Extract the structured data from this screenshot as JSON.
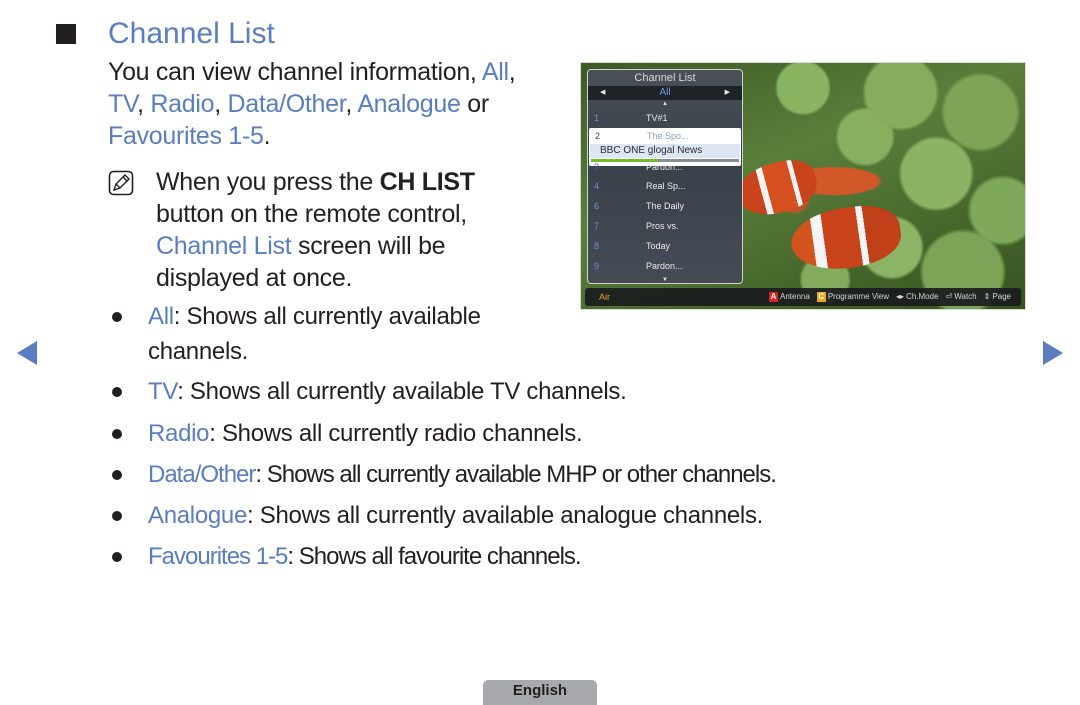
{
  "heading": {
    "title": "Channel List"
  },
  "intro": {
    "prefix": "You can view channel information, ",
    "links": [
      "All",
      "TV",
      "Radio",
      "Data/Other",
      "Analogue",
      "Favourites 1-5"
    ],
    "sep_comma": ", ",
    "sep_or": " or ",
    "end": "."
  },
  "note": {
    "text_before": "When you press the ",
    "key_label": "CH LIST",
    "text_middle": " button on the remote control, ",
    "link": "Channel List",
    "text_after": " screen will be displayed at once."
  },
  "bullets": [
    {
      "term": "All",
      "desc": ": Shows all currently available channels."
    },
    {
      "term": "TV",
      "desc": ": Shows all currently available TV channels."
    },
    {
      "term": "Radio",
      "desc": ": Shows all currently radio channels."
    },
    {
      "term": "Data/Other",
      "desc": ": Shows all currently available MHP or other channels."
    },
    {
      "term": "Analogue",
      "desc": ": Shows all currently available analogue channels."
    },
    {
      "term": "Favourites 1-5",
      "desc": ": Shows all favourite channels."
    }
  ],
  "navigation": {
    "prev_icon": "triangle-left-icon",
    "next_icon": "triangle-right-icon"
  },
  "footer": {
    "language": "English"
  },
  "tv_screen": {
    "panel_title": "Channel List",
    "current_tab": "All",
    "channels": [
      {
        "number": "1",
        "name": "TV#1"
      },
      {
        "number": "2",
        "name": "The Spo...",
        "selected": true,
        "program": "BBC ONE glogal News",
        "progress": 0.45
      },
      {
        "number": "3",
        "name": "Pardon..."
      },
      {
        "number": "4",
        "name": "Real Sp..."
      },
      {
        "number": "6",
        "name": "The Daily"
      },
      {
        "number": "7",
        "name": "Pros vs."
      },
      {
        "number": "8",
        "name": "Today"
      },
      {
        "number": "9",
        "name": "Pardon..."
      }
    ],
    "source": "Air",
    "hints": [
      {
        "key": "A",
        "label": "Antenna"
      },
      {
        "key": "C",
        "label": "Programme View"
      },
      {
        "glyph": "◂▸",
        "label": "Ch.Mode"
      },
      {
        "glyph": "⏎",
        "label": "Watch"
      },
      {
        "glyph": "⇕",
        "label": "Page"
      }
    ],
    "colors": {
      "key_a": "#e02020",
      "key_c": "#f0a81a",
      "source": "#f3a21c",
      "progress": "#6fbf2a",
      "tab_active": "#6f9be0"
    }
  },
  "colors": {
    "accent": "#5a7dc0",
    "text": "#231f20",
    "language_tab": "#a7a9ac"
  }
}
